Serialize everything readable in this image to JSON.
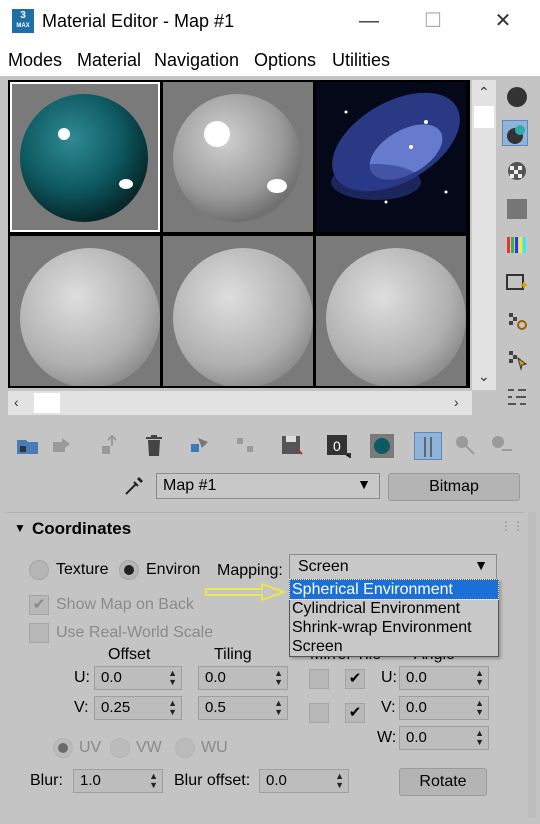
{
  "window": {
    "app_icon": "3",
    "app_icon_sub": "MAX",
    "title": "Material Editor - Map #1",
    "minimize": "—",
    "maximize": "☐",
    "close": "✕"
  },
  "menu": [
    "Modes",
    "Material",
    "Navigation",
    "Options",
    "Utilities"
  ],
  "slots": [
    "teal-sphere",
    "glossy-grey-sphere",
    "nebula-bitmap",
    "default-sphere",
    "default-sphere",
    "default-sphere"
  ],
  "map_row": {
    "name": "Map #1",
    "type_button": "Bitmap"
  },
  "rollout": {
    "title": "Coordinates",
    "radio_texture": "Texture",
    "radio_environ": "Environ",
    "mapping_label": "Mapping:",
    "mapping_value": "Screen",
    "mapping_options": [
      "Spherical Environment",
      "Cylindrical Environment",
      "Shrink-wrap Environment",
      "Screen"
    ],
    "selected_option": "Spherical Environment",
    "show_map_on_back": "Show Map on Back",
    "use_real_world": "Use Real-World Scale",
    "offset_label": "Offset",
    "tiling_label": "Tiling",
    "mirror_tile_label": "Mirror Tile",
    "angle_label": "Angle",
    "u_label": "U:",
    "v_label": "V:",
    "w_label": "W:",
    "offset_u": "0.0",
    "offset_v": "0.25",
    "tiling_u": "0.0",
    "tiling_v": "0.5",
    "angle_u": "0.0",
    "angle_v": "0.0",
    "angle_w": "0.0",
    "uv": "UV",
    "vw": "VW",
    "wu": "WU",
    "blur_label": "Blur:",
    "blur_value": "1.0",
    "blur_offset_label": "Blur offset:",
    "blur_offset_value": "0.0",
    "rotate": "Rotate"
  },
  "colors": {
    "accent": "#1a70d8",
    "teal": "#0e5a62",
    "panel": "#c4c4c4",
    "arrow": "#e8e84a"
  }
}
